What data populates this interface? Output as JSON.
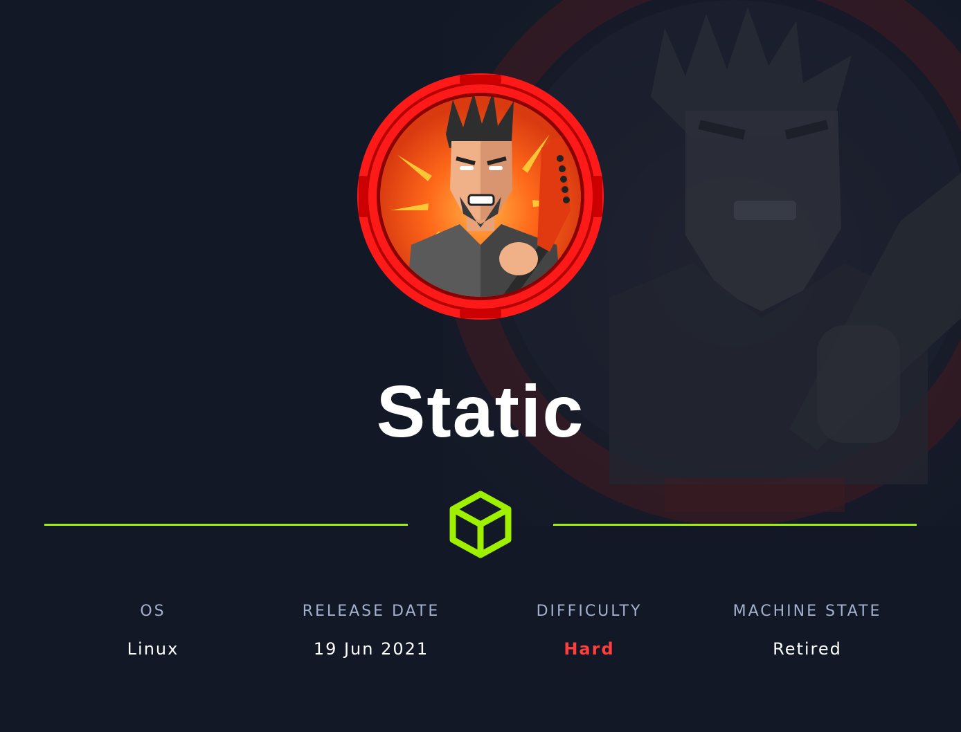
{
  "machine": {
    "name": "Static"
  },
  "stats": [
    {
      "label": "OS",
      "value": "Linux"
    },
    {
      "label": "RELEASE DATE",
      "value": "19 Jun 2021"
    },
    {
      "label": "DIFFICULTY",
      "value": "Hard"
    },
    {
      "label": "MACHINE STATE",
      "value": "Retired"
    }
  ],
  "colors": {
    "background": "#121826",
    "accent_green": "#9fef00",
    "difficulty_hard": "#ff3e3e",
    "label": "#a4b1cd",
    "avatar_ring": "#ff1a1a"
  },
  "icons": {
    "avatar": "rocker-guitar-avatar",
    "divider": "cube-icon"
  }
}
